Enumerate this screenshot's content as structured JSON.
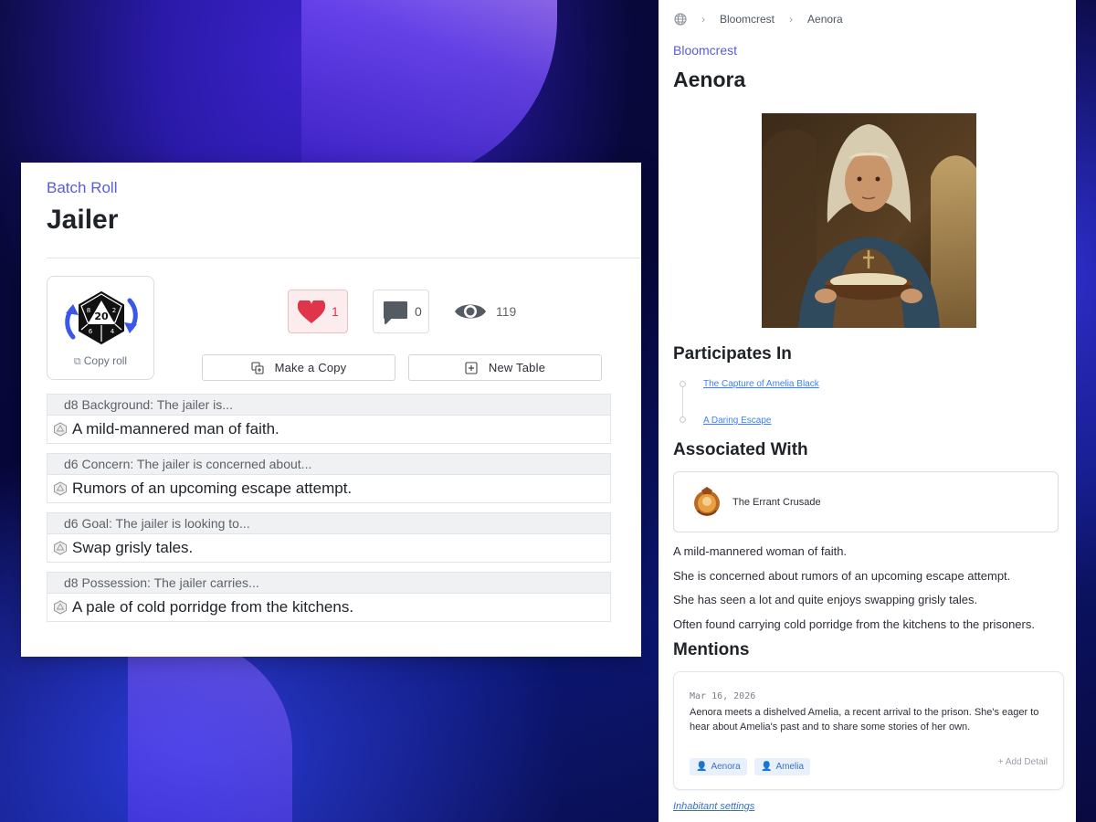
{
  "batch_roll": {
    "kicker": "Batch Roll",
    "title": "Jailer",
    "copy_roll_label": "Copy roll",
    "likes": "1",
    "comments": "0",
    "views": "119",
    "make_copy_label": "Make a Copy",
    "new_table_label": "New Table",
    "rolls": [
      {
        "header": "d8 Background: The jailer is...",
        "result": "A mild-mannered man of faith."
      },
      {
        "header": "d6 Concern: The jailer is concerned about...",
        "result": "Rumors of an upcoming escape attempt."
      },
      {
        "header": "d6 Goal: The jailer is looking to...",
        "result": "Swap grisly tales."
      },
      {
        "header": "d8 Possession: The jailer carries...",
        "result": "A pale of cold porridge from the kitchens."
      }
    ],
    "colors": {
      "accent": "#5b5bd6",
      "like": "#e0344b"
    }
  },
  "inhabitant": {
    "breadcrumb": [
      "Bloomcrest",
      "Aenora"
    ],
    "kicker": "Bloomcrest",
    "name": "Aenora",
    "participates_heading": "Participates In",
    "participates": [
      "The Capture of Amelia Black",
      "A Daring Escape"
    ],
    "associated_heading": "Associated With",
    "associated": [
      "The Errant Crusade"
    ],
    "description": [
      "A mild-mannered woman of faith.",
      "She is concerned about rumors of an upcoming escape attempt.",
      "She has seen a lot and quite enjoys swapping grisly tales.",
      "Often found carrying cold porridge from the kitchens to the prisoners."
    ],
    "mentions_heading": "Mentions",
    "mention": {
      "date": "Mar 16, 2026",
      "text": "Aenora meets a dishelved Amelia, a recent arrival to the prison. She's eager to hear about Amelia's past and to share some stories of her own.",
      "tags": [
        "Aenora",
        "Amelia"
      ],
      "add_detail": "+ Add Detail"
    },
    "settings_link": "Inhabitant settings"
  }
}
